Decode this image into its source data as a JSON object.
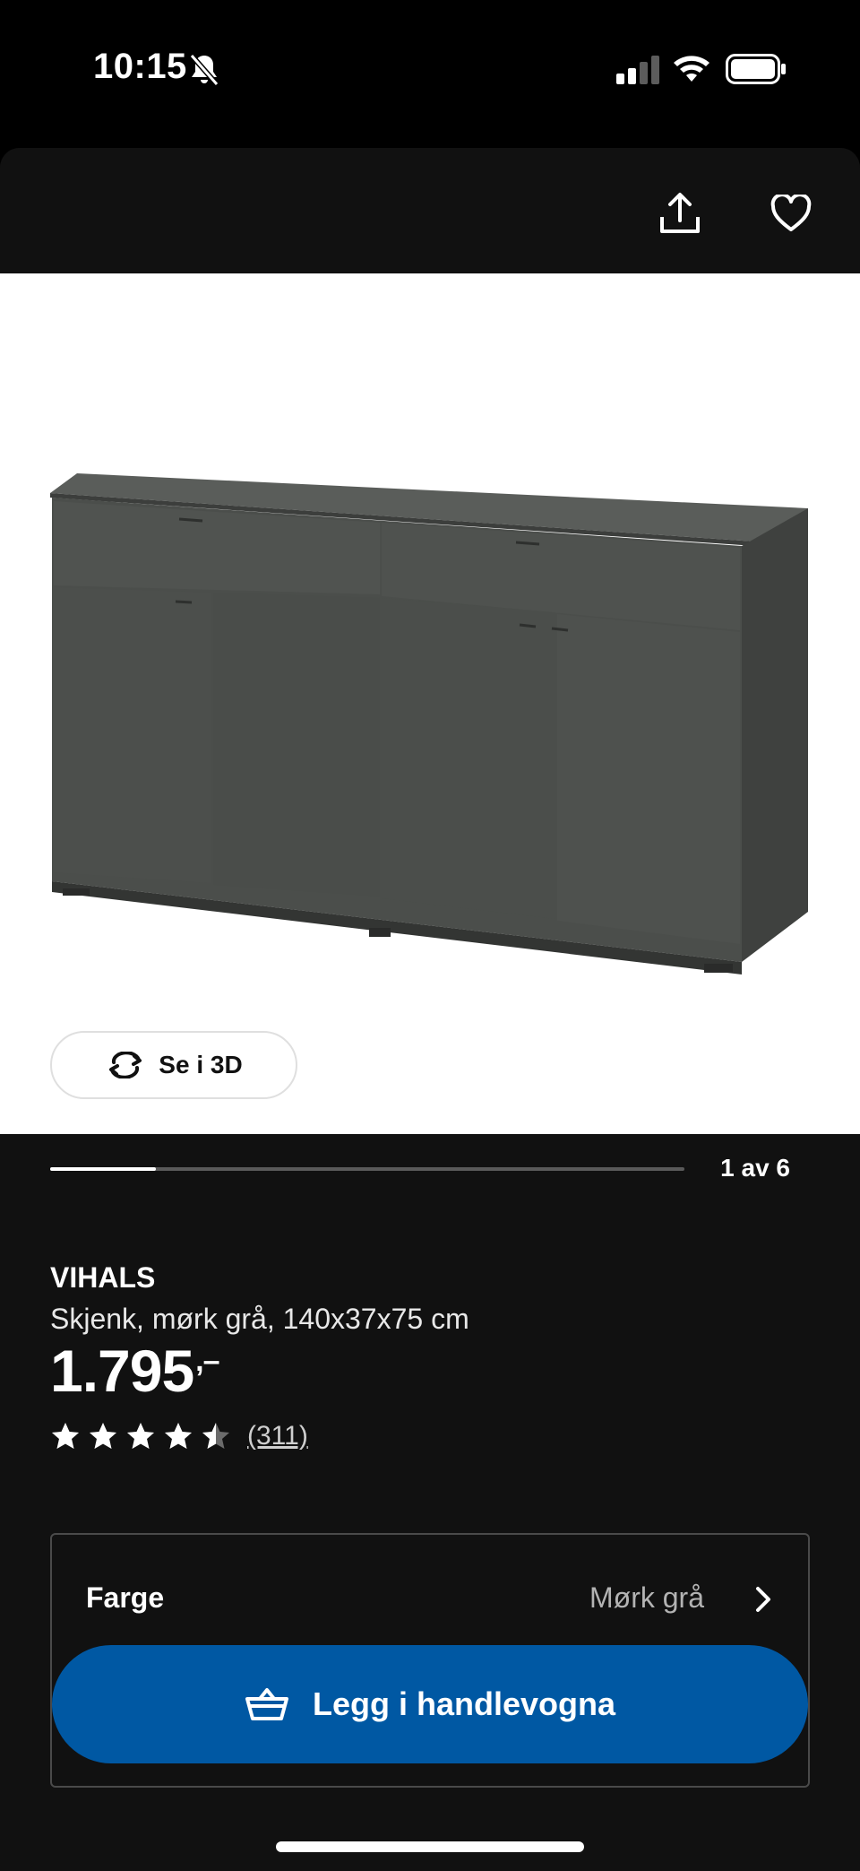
{
  "status_bar": {
    "time": "10:15"
  },
  "icons": {
    "bell_off": "bell-off-icon",
    "signal": "signal-icon",
    "wifi": "wifi-icon",
    "battery": "battery-icon",
    "share": "share-icon",
    "favorite": "heart-icon",
    "rotate": "rotate-icon",
    "cart": "basket-icon",
    "chevron": "chevron-right-icon",
    "star": "star-icon"
  },
  "gallery": {
    "view_3d_label": "Se i 3D",
    "page_indicator": "1 av 6",
    "progress": 0.1667
  },
  "product": {
    "name": "VIHALS",
    "description": "Skjenk, mørk grå, 140x37x75 cm",
    "price": "1.795",
    "price_suffix": ",–",
    "rating": 4.5,
    "review_count": "(311)"
  },
  "variant": {
    "label": "Farge",
    "value": "Mørk grå"
  },
  "cart": {
    "button_label": "Legg i handlevogna"
  },
  "colors": {
    "accent": "#0058a3",
    "sheet_background": "#111111",
    "product_grey": "#4e514e"
  }
}
